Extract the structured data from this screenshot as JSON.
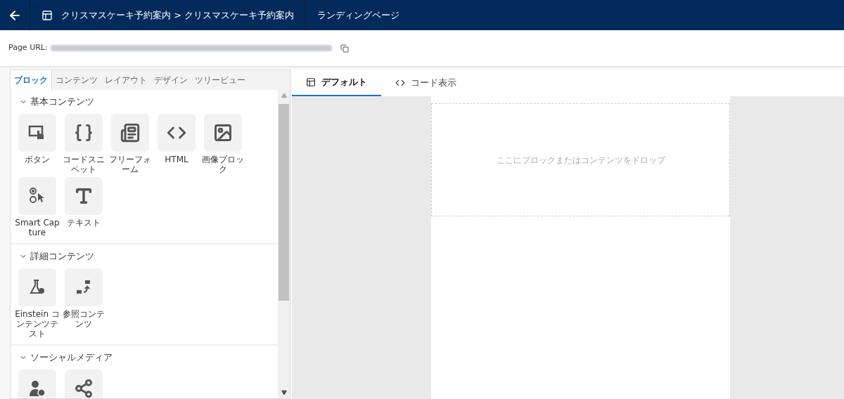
{
  "header": {
    "breadcrumb": "クリスマスケーキ予約案内 > クリスマスケーキ予約案内",
    "page_type": "ランディングページ"
  },
  "url_bar": {
    "label": "Page URL:"
  },
  "panel_tabs": [
    {
      "label": "ブロック",
      "selected": true
    },
    {
      "label": "コンテンツ",
      "selected": false
    },
    {
      "label": "レイアウト",
      "selected": false
    },
    {
      "label": "デザイン",
      "selected": false
    },
    {
      "label": "ツリービュー",
      "selected": false
    }
  ],
  "sections": [
    {
      "title": "基本コンテンツ",
      "expanded": true,
      "items": [
        {
          "kind": "button",
          "label": "ボタン"
        },
        {
          "kind": "code",
          "label": "コードスニペット"
        },
        {
          "kind": "form",
          "label": "フリーフォーム"
        },
        {
          "kind": "html",
          "label": "HTML"
        },
        {
          "kind": "image",
          "label": "画像ブロック"
        },
        {
          "kind": "capture",
          "label": "Smart Capture"
        },
        {
          "kind": "text",
          "label": "テキスト"
        }
      ]
    },
    {
      "title": "詳細コンテンツ",
      "expanded": true,
      "items": [
        {
          "kind": "flask",
          "label": "Einstein コンテンツテスト"
        },
        {
          "kind": "reference",
          "label": "参照コンテンツ"
        }
      ]
    },
    {
      "title": "ソーシャルメディア",
      "expanded": true,
      "items": [
        {
          "kind": "person-share"
        },
        {
          "kind": "share"
        }
      ]
    }
  ],
  "view_tabs": [
    {
      "kind": "layout",
      "label": "デフォルト",
      "selected": true
    },
    {
      "kind": "code",
      "label": "コード表示",
      "selected": false
    }
  ],
  "canvas": {
    "drop_hint": "ここにブロックまたはコンテンツをドロップ"
  }
}
